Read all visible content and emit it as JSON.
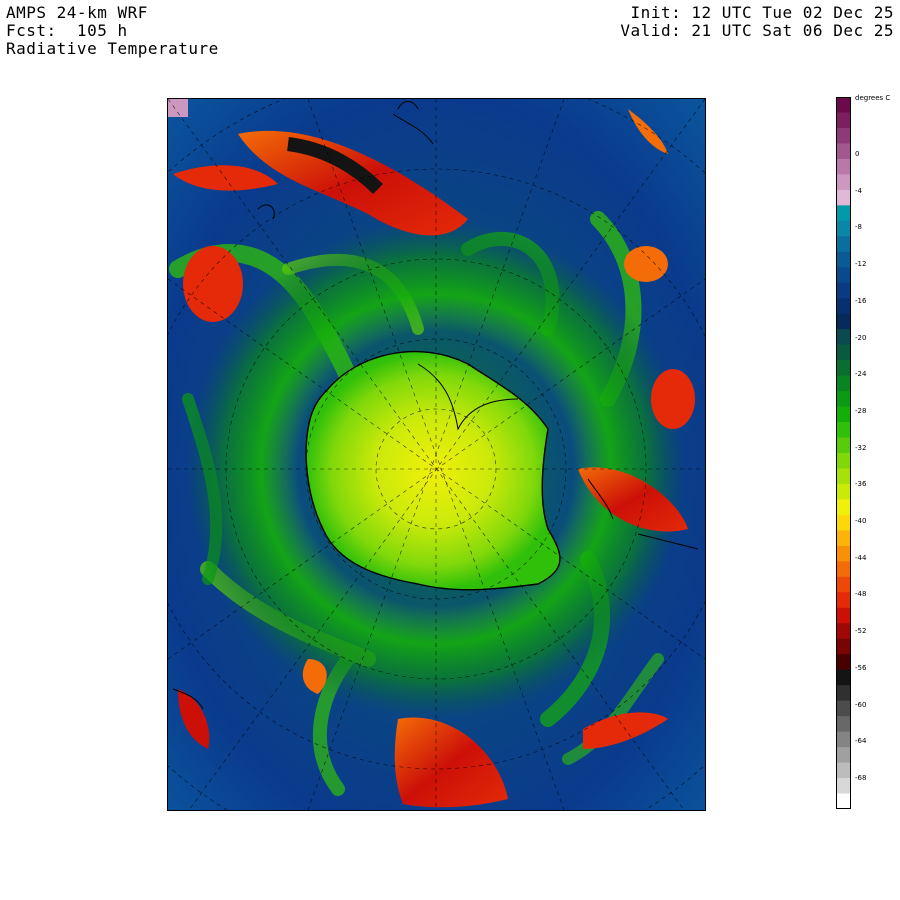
{
  "header": {
    "model_line": "AMPS 24-km WRF",
    "fcst_line": "Fcst:  105 h",
    "field_line": "Radiative Temperature",
    "init_line": "Init: 12 UTC Tue 02 Dec 25",
    "valid_line": "Valid: 21 UTC Sat 06 Dec 25"
  },
  "colorbar": {
    "unit": "degrees C",
    "ticks": [
      "0",
      "-4",
      "-8",
      "-12",
      "-16",
      "-20",
      "-24",
      "-28",
      "-32",
      "-36",
      "-40",
      "-44",
      "-48",
      "-52",
      "-56",
      "-60",
      "-64",
      "-68"
    ],
    "colors": [
      "#6a0a4a",
      "#7a2060",
      "#8c3a78",
      "#a0588f",
      "#b878a8",
      "#cc98c0",
      "#e0b8d8",
      "#009aa8",
      "#0a86a6",
      "#0a6e9e",
      "#0a5a94",
      "#0a4a8c",
      "#0a3a80",
      "#06306e",
      "#062a5a",
      "#0a4a50",
      "#0a5a40",
      "#0a6e30",
      "#0a8420",
      "#0a9a14",
      "#14ae0a",
      "#30c00a",
      "#58cc0a",
      "#80d80a",
      "#a8e00a",
      "#ccea0a",
      "#f0f00a",
      "#fcd80a",
      "#fcb40a",
      "#f89008",
      "#f46c08",
      "#ee4808",
      "#e42a08",
      "#cc1008",
      "#a00808",
      "#780404",
      "#480000",
      "#141414",
      "#303030",
      "#4c4c4c",
      "#686868",
      "#848484",
      "#a0a0a0",
      "#bcbcbc",
      "#d8d8d8",
      "#ffffff"
    ]
  }
}
